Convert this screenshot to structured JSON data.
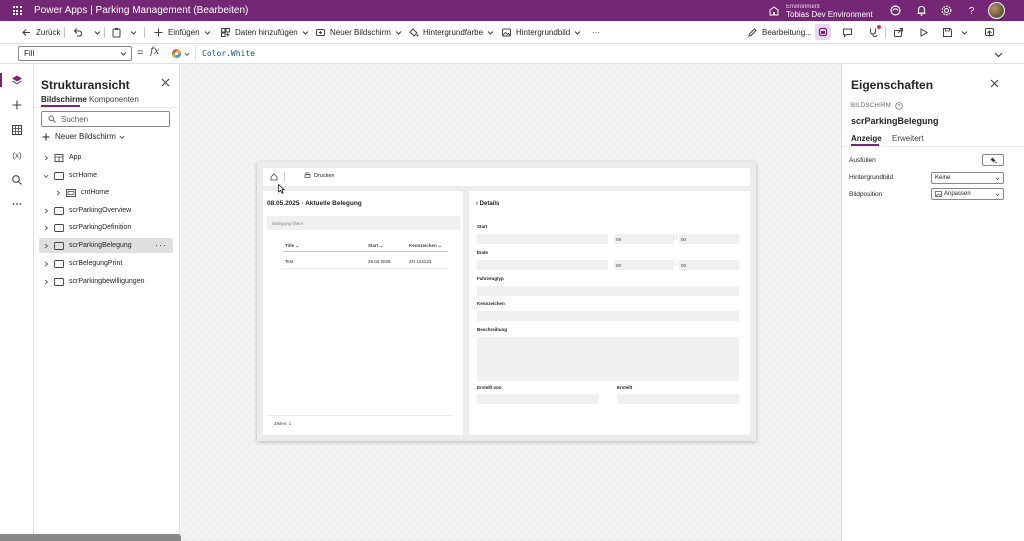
{
  "app": {
    "title": "Power Apps  |  Parking Management (Bearbeiten)",
    "environment_label": "Environment",
    "environment_name": "Tobias Dev Environment"
  },
  "toolbar": {
    "back_label": "Zurück",
    "insert_label": "Einfügen",
    "add_data_label": "Daten hinzufügen",
    "new_screen_label": "Neuer Bildschirm",
    "background_color_label": "Hintergrundfarbe",
    "background_image_label": "Hintergrundbild",
    "more_label": "···",
    "edit_label": "Bearbeitung..."
  },
  "formula": {
    "property": "Fill",
    "equals": "=",
    "fx": "fx",
    "value": "Color.White"
  },
  "tree": {
    "title": "Strukturansicht",
    "tabs": [
      "Bildschirme",
      "Komponenten"
    ],
    "search_placeholder": "Suchen",
    "new_screen_label": "Neuer Bildschirm",
    "items": [
      {
        "label": "App",
        "icon": "app-icon"
      },
      {
        "label": "scrHome",
        "icon": "screen-icon"
      },
      {
        "label": "cntHome",
        "icon": "container-icon"
      },
      {
        "label": "scrParkingOverview",
        "icon": "screen-icon"
      },
      {
        "label": "scrParkingDefinition",
        "icon": "screen-icon"
      },
      {
        "label": "scrParkingBelegung",
        "icon": "screen-icon"
      },
      {
        "label": "scrBelegungPrint",
        "icon": "screen-icon"
      },
      {
        "label": "scrParkingbewilligungen",
        "icon": "screen-icon"
      }
    ],
    "selected_more": "···"
  },
  "canvas": {
    "print_label": "Drucken",
    "list_title": "08.05.2025 · Aktuelle Belegung",
    "filter_placeholder": "Belegung filtern",
    "columns": [
      "Title",
      "Start",
      "Kennzeichen"
    ],
    "rows": [
      [
        "Test",
        "26.04.2025",
        "ZH 123123"
      ]
    ],
    "rows_count": "Zeilen: 1",
    "details": {
      "title": "Details",
      "start_label": "Start",
      "start_hour": "08",
      "start_minute": "00",
      "end_label": "Ende",
      "end_hour": "00",
      "end_minute": "00",
      "vehicle_type_label": "Fahrzeugtyp",
      "plate_label": "Kennzeichen",
      "description_label": "Beschreibung",
      "created_by_label": "Erstellt von",
      "created_label": "Erstellt"
    }
  },
  "properties": {
    "title": "Eigenschaften",
    "type": "BILDSCHIRM",
    "name": "scrParkingBelegung",
    "tabs": [
      "Anzeige",
      "Erweitert"
    ],
    "fill_label": "Ausfüllen",
    "bg_image_label": "Hintergrundbild",
    "bg_image_value": "Keine",
    "image_position_label": "Bildposition",
    "image_position_value": "Anpassen"
  },
  "colors": {
    "brand": "#742774",
    "canvas_bg": "#f3f2f1"
  }
}
